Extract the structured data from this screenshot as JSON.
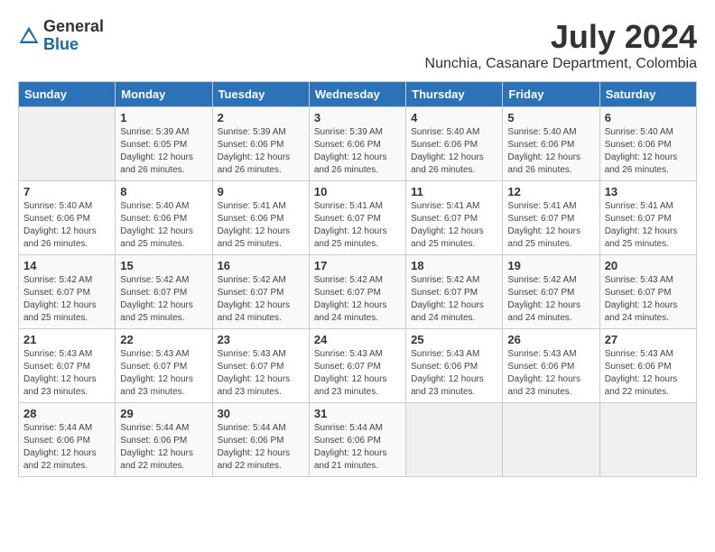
{
  "header": {
    "logo_general": "General",
    "logo_blue": "Blue",
    "month_year": "July 2024",
    "location": "Nunchia, Casanare Department, Colombia"
  },
  "days_of_week": [
    "Sunday",
    "Monday",
    "Tuesday",
    "Wednesday",
    "Thursday",
    "Friday",
    "Saturday"
  ],
  "weeks": [
    [
      {
        "day": "",
        "info": ""
      },
      {
        "day": "1",
        "info": "Sunrise: 5:39 AM\nSunset: 6:05 PM\nDaylight: 12 hours\nand 26 minutes."
      },
      {
        "day": "2",
        "info": "Sunrise: 5:39 AM\nSunset: 6:06 PM\nDaylight: 12 hours\nand 26 minutes."
      },
      {
        "day": "3",
        "info": "Sunrise: 5:39 AM\nSunset: 6:06 PM\nDaylight: 12 hours\nand 26 minutes."
      },
      {
        "day": "4",
        "info": "Sunrise: 5:40 AM\nSunset: 6:06 PM\nDaylight: 12 hours\nand 26 minutes."
      },
      {
        "day": "5",
        "info": "Sunrise: 5:40 AM\nSunset: 6:06 PM\nDaylight: 12 hours\nand 26 minutes."
      },
      {
        "day": "6",
        "info": "Sunrise: 5:40 AM\nSunset: 6:06 PM\nDaylight: 12 hours\nand 26 minutes."
      }
    ],
    [
      {
        "day": "7",
        "info": "Sunrise: 5:40 AM\nSunset: 6:06 PM\nDaylight: 12 hours\nand 26 minutes."
      },
      {
        "day": "8",
        "info": "Sunrise: 5:40 AM\nSunset: 6:06 PM\nDaylight: 12 hours\nand 25 minutes."
      },
      {
        "day": "9",
        "info": "Sunrise: 5:41 AM\nSunset: 6:06 PM\nDaylight: 12 hours\nand 25 minutes."
      },
      {
        "day": "10",
        "info": "Sunrise: 5:41 AM\nSunset: 6:07 PM\nDaylight: 12 hours\nand 25 minutes."
      },
      {
        "day": "11",
        "info": "Sunrise: 5:41 AM\nSunset: 6:07 PM\nDaylight: 12 hours\nand 25 minutes."
      },
      {
        "day": "12",
        "info": "Sunrise: 5:41 AM\nSunset: 6:07 PM\nDaylight: 12 hours\nand 25 minutes."
      },
      {
        "day": "13",
        "info": "Sunrise: 5:41 AM\nSunset: 6:07 PM\nDaylight: 12 hours\nand 25 minutes."
      }
    ],
    [
      {
        "day": "14",
        "info": "Sunrise: 5:42 AM\nSunset: 6:07 PM\nDaylight: 12 hours\nand 25 minutes."
      },
      {
        "day": "15",
        "info": "Sunrise: 5:42 AM\nSunset: 6:07 PM\nDaylight: 12 hours\nand 25 minutes."
      },
      {
        "day": "16",
        "info": "Sunrise: 5:42 AM\nSunset: 6:07 PM\nDaylight: 12 hours\nand 24 minutes."
      },
      {
        "day": "17",
        "info": "Sunrise: 5:42 AM\nSunset: 6:07 PM\nDaylight: 12 hours\nand 24 minutes."
      },
      {
        "day": "18",
        "info": "Sunrise: 5:42 AM\nSunset: 6:07 PM\nDaylight: 12 hours\nand 24 minutes."
      },
      {
        "day": "19",
        "info": "Sunrise: 5:42 AM\nSunset: 6:07 PM\nDaylight: 12 hours\nand 24 minutes."
      },
      {
        "day": "20",
        "info": "Sunrise: 5:43 AM\nSunset: 6:07 PM\nDaylight: 12 hours\nand 24 minutes."
      }
    ],
    [
      {
        "day": "21",
        "info": "Sunrise: 5:43 AM\nSunset: 6:07 PM\nDaylight: 12 hours\nand 23 minutes."
      },
      {
        "day": "22",
        "info": "Sunrise: 5:43 AM\nSunset: 6:07 PM\nDaylight: 12 hours\nand 23 minutes."
      },
      {
        "day": "23",
        "info": "Sunrise: 5:43 AM\nSunset: 6:07 PM\nDaylight: 12 hours\nand 23 minutes."
      },
      {
        "day": "24",
        "info": "Sunrise: 5:43 AM\nSunset: 6:07 PM\nDaylight: 12 hours\nand 23 minutes."
      },
      {
        "day": "25",
        "info": "Sunrise: 5:43 AM\nSunset: 6:06 PM\nDaylight: 12 hours\nand 23 minutes."
      },
      {
        "day": "26",
        "info": "Sunrise: 5:43 AM\nSunset: 6:06 PM\nDaylight: 12 hours\nand 23 minutes."
      },
      {
        "day": "27",
        "info": "Sunrise: 5:43 AM\nSunset: 6:06 PM\nDaylight: 12 hours\nand 22 minutes."
      }
    ],
    [
      {
        "day": "28",
        "info": "Sunrise: 5:44 AM\nSunset: 6:06 PM\nDaylight: 12 hours\nand 22 minutes."
      },
      {
        "day": "29",
        "info": "Sunrise: 5:44 AM\nSunset: 6:06 PM\nDaylight: 12 hours\nand 22 minutes."
      },
      {
        "day": "30",
        "info": "Sunrise: 5:44 AM\nSunset: 6:06 PM\nDaylight: 12 hours\nand 22 minutes."
      },
      {
        "day": "31",
        "info": "Sunrise: 5:44 AM\nSunset: 6:06 PM\nDaylight: 12 hours\nand 21 minutes."
      },
      {
        "day": "",
        "info": ""
      },
      {
        "day": "",
        "info": ""
      },
      {
        "day": "",
        "info": ""
      }
    ]
  ]
}
